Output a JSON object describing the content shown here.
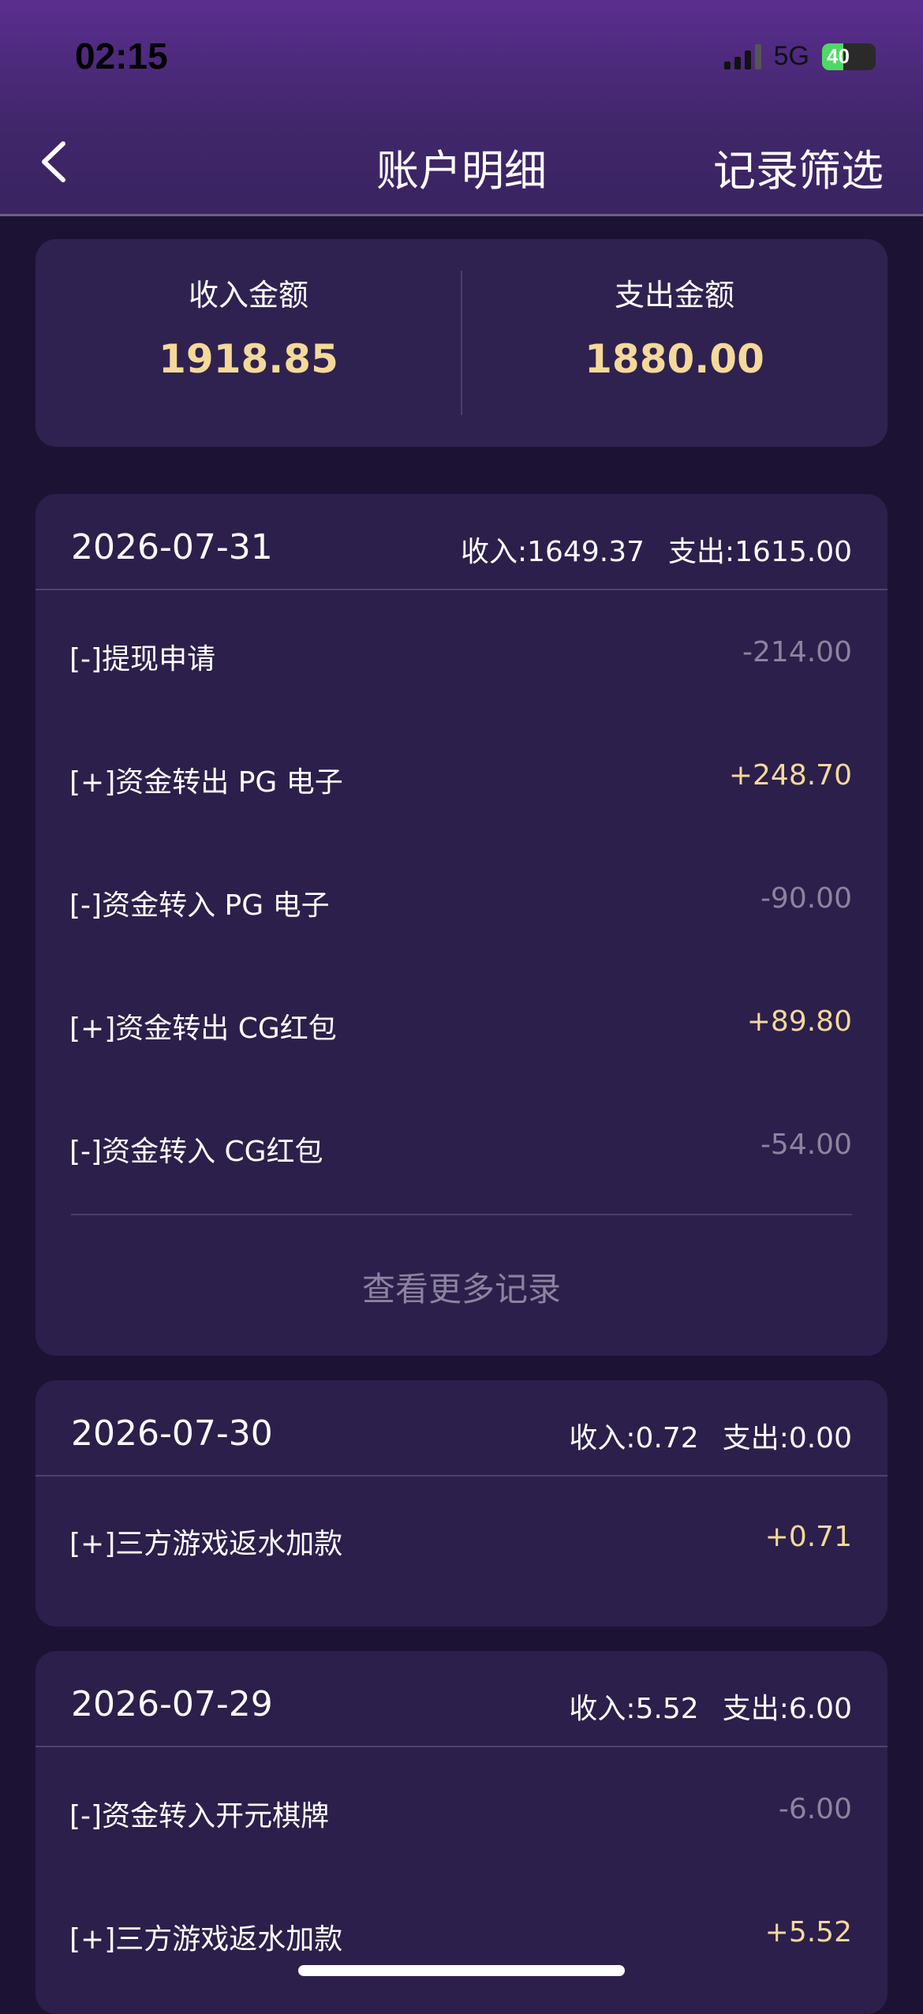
{
  "status_bar": {
    "time": "02:15",
    "network": "5G",
    "battery": "40",
    "battery_level": 0.4
  },
  "nav": {
    "title": "账户明细",
    "filter_label": "记录筛选",
    "back_icon": "chevron-left-icon"
  },
  "summary": {
    "income_label": "收入金额",
    "income_value": "1918.85",
    "expense_label": "支出金额",
    "expense_value": "1880.00"
  },
  "days": [
    {
      "date": "2026-07-31",
      "income": "收入:1649.37",
      "expense": "支出:1615.00",
      "rows": [
        {
          "label": "[-]提现申请",
          "amount": "-214.00"
        },
        {
          "label": "[+]资金转出 PG 电子",
          "amount": "+248.70"
        },
        {
          "label": "[-]资金转入 PG 电子",
          "amount": "-90.00"
        },
        {
          "label": "[+]资金转出 CG红包",
          "amount": "+89.80"
        },
        {
          "label": "[-]资金转入 CG红包",
          "amount": "-54.00"
        }
      ],
      "more_label": "查看更多记录"
    },
    {
      "date": "2026-07-30",
      "income": "收入:0.72",
      "expense": "支出:0.00",
      "rows": [
        {
          "label": "[+]三方游戏返水加款",
          "amount": "+0.71"
        }
      ]
    },
    {
      "date": "2026-07-29",
      "income": "收入:5.52",
      "expense": "支出:6.00",
      "rows": [
        {
          "label": "[-]资金转入开元棋牌",
          "amount": "-6.00"
        },
        {
          "label": "[+]三方游戏返水加款",
          "amount": "+5.52"
        }
      ]
    }
  ],
  "colors": {
    "positive": "#f4d99a",
    "negative": "#8c839f",
    "card": "#2c1f4b",
    "background": "#1c1334"
  }
}
